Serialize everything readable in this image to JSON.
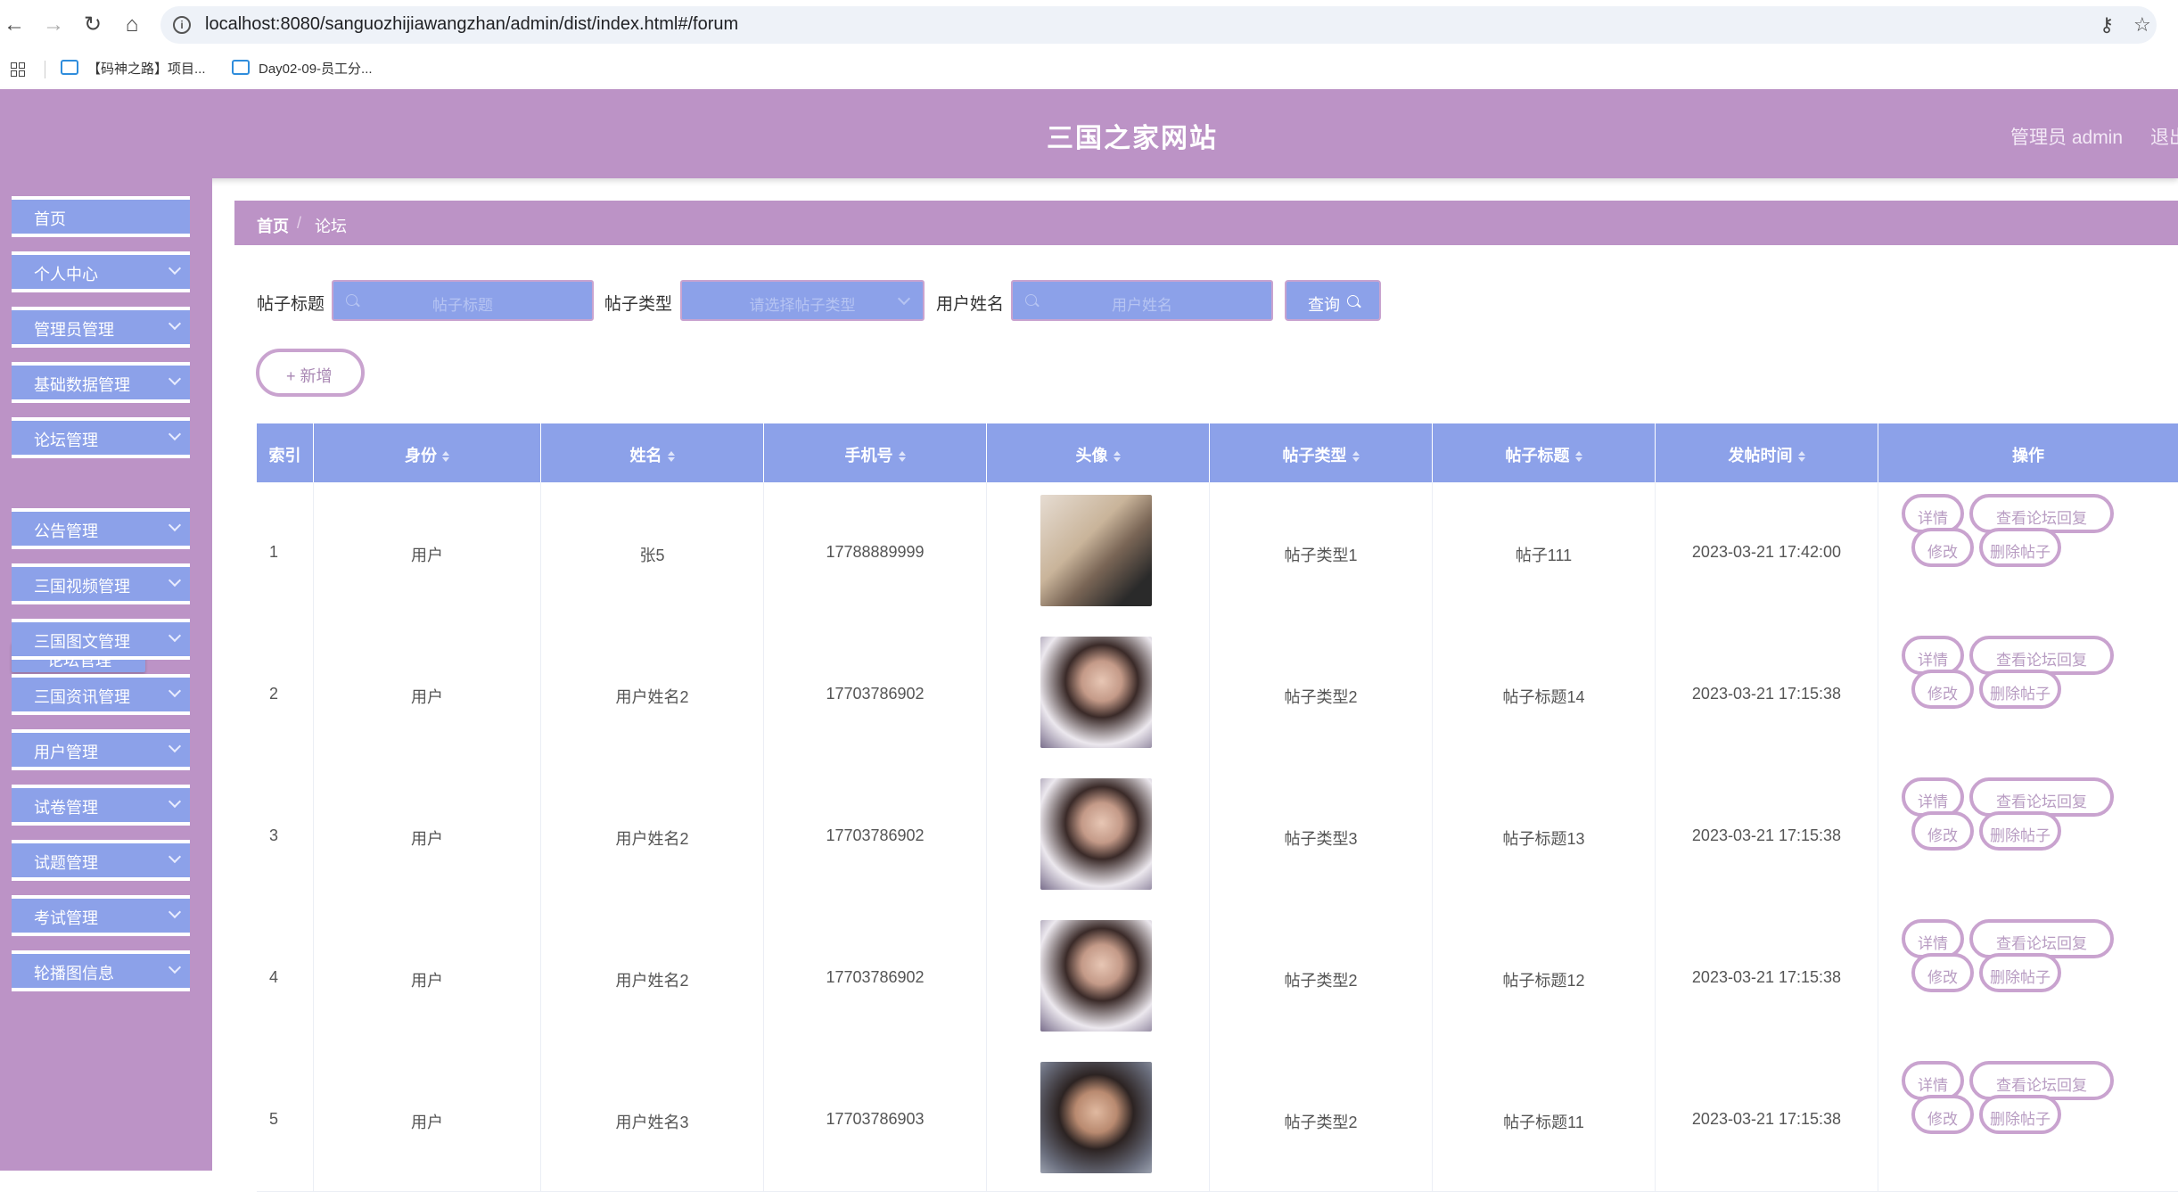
{
  "browser": {
    "url": "localhost:8080/sanguozhijiawangzhan/admin/dist/index.html#/forum",
    "bookmarks": [
      "【码神之路】项目...",
      "Day02-09-员工分..."
    ]
  },
  "header": {
    "title": "三国之家网站",
    "admin_label": "管理员 admin",
    "logout_label": "退出"
  },
  "sidebar": {
    "items": [
      {
        "label": "首页"
      },
      {
        "label": "个人中心"
      },
      {
        "label": "管理员管理"
      },
      {
        "label": "基础数据管理"
      },
      {
        "label": "论坛管理"
      },
      {
        "label": "公告管理"
      },
      {
        "label": "三国视频管理"
      },
      {
        "label": "三国图文管理"
      },
      {
        "label": "三国资讯管理"
      },
      {
        "label": "用户管理"
      },
      {
        "label": "试卷管理"
      },
      {
        "label": "试题管理"
      },
      {
        "label": "考试管理"
      },
      {
        "label": "轮播图信息"
      }
    ],
    "active_sub": "论坛管理"
  },
  "breadcrumb": {
    "home": "首页",
    "separator": "/",
    "current": "论坛"
  },
  "filters": {
    "title_label": "帖子标题",
    "title_placeholder": "帖子标题",
    "type_label": "帖子类型",
    "type_placeholder": "请选择帖子类型",
    "user_label": "用户姓名",
    "user_placeholder": "用户姓名",
    "query_label": "查询",
    "add_label": "+ 新增"
  },
  "table": {
    "columns": [
      "索引",
      "身份",
      "姓名",
      "手机号",
      "头像",
      "帖子类型",
      "帖子标题",
      "发帖时间",
      "操作"
    ],
    "rows": [
      {
        "index": "1",
        "role": "用户",
        "name": "张5",
        "phone": "17788889999",
        "type": "帖子类型1",
        "title": "帖子111",
        "time": "2023-03-21 17:42:00"
      },
      {
        "index": "2",
        "role": "用户",
        "name": "用户姓名2",
        "phone": "17703786902",
        "type": "帖子类型2",
        "title": "帖子标题14",
        "time": "2023-03-21 17:15:38"
      },
      {
        "index": "3",
        "role": "用户",
        "name": "用户姓名2",
        "phone": "17703786902",
        "type": "帖子类型3",
        "title": "帖子标题13",
        "time": "2023-03-21 17:15:38"
      },
      {
        "index": "4",
        "role": "用户",
        "name": "用户姓名2",
        "phone": "17703786902",
        "type": "帖子类型2",
        "title": "帖子标题12",
        "time": "2023-03-21 17:15:38"
      },
      {
        "index": "5",
        "role": "用户",
        "name": "用户姓名3",
        "phone": "17703786903",
        "type": "帖子类型2",
        "title": "帖子标题11",
        "time": "2023-03-21 17:15:38"
      }
    ],
    "actions": {
      "detail": "详情",
      "view_reply": "查看论坛回复",
      "edit": "修改",
      "delete": "删除帖子"
    }
  },
  "colors": {
    "header": "#bc93c6",
    "accent": "#8ca1e9",
    "border": "#c9a3cf"
  }
}
